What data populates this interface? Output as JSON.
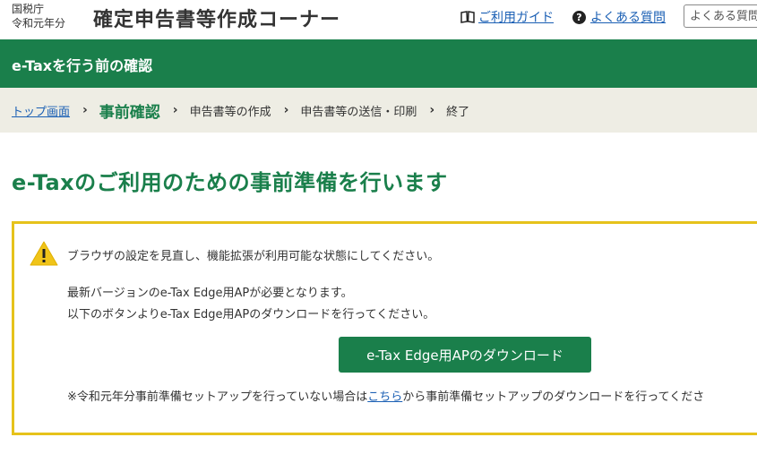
{
  "header": {
    "agency_line1": "国税庁",
    "agency_line2": "令和元年分",
    "title": "確定申告書等作成コーナー",
    "guide_link": "ご利用ガイド",
    "faq_link": "よくある質問",
    "search_placeholder": "よくある質問"
  },
  "bar": {
    "title": "e-Taxを行う前の確認"
  },
  "breadcrumb": {
    "items": [
      "トップ画面",
      "事前確認",
      "申告書等の作成",
      "申告書等の送信・印刷",
      "終了"
    ]
  },
  "main": {
    "heading": "e-Taxのご利用のための事前準備を行います",
    "notice": {
      "line1": "ブラウザの設定を見直し、機能拡張が利用可能な状態にしてください。",
      "line2": "最新バージョンのe-Tax Edge用APが必要となります。",
      "line3": "以下のボタンよりe-Tax Edge用APのダウンロードを行ってください。",
      "button": "e-Tax Edge用APのダウンロード",
      "note_before": "※令和元年分事前準備セットアップを行っていない場合は",
      "note_link": "こちら",
      "note_after": "から事前準備セットアップのダウンロードを行ってくださ"
    }
  },
  "colors": {
    "brand_green": "#1a7f4b",
    "warning_yellow": "#e6c21b",
    "breadcrumb_bg": "#eeede4",
    "link_blue": "#1a5fb4"
  }
}
